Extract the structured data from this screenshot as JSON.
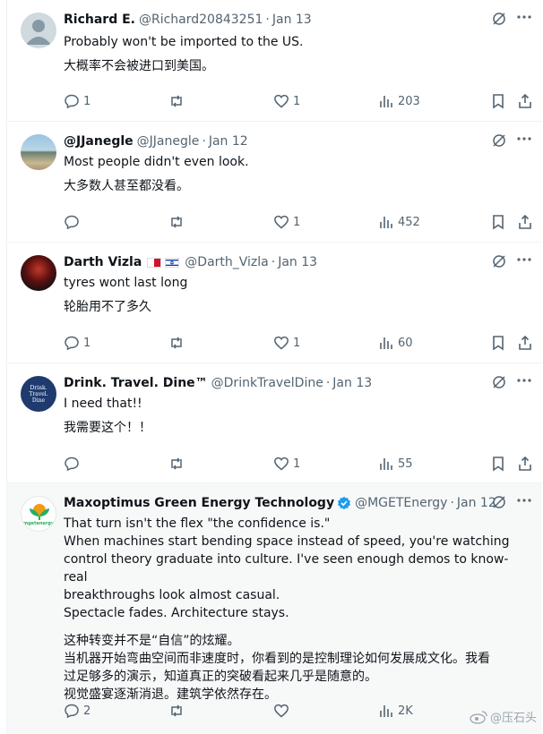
{
  "tweets": [
    {
      "name": "Richard E.",
      "handle": "@Richard20843251",
      "time": "Jan 13",
      "text": [
        "Probably won't be imported to the US."
      ],
      "translation": [
        "大概率不会被进口到美国。"
      ],
      "replies": "1",
      "retweets": "",
      "likes": "1",
      "views": "203"
    },
    {
      "name": "@JJanegle",
      "handle": "@JJanegle",
      "time": "Jan 12",
      "text": [
        "Most people didn't even look."
      ],
      "translation": [
        "大多数人甚至都没看。"
      ],
      "replies": "",
      "retweets": "",
      "likes": "1",
      "views": "452"
    },
    {
      "name": "Darth Vizla",
      "handle": "@Darth_Vizla",
      "time": "Jan 13",
      "text": [
        "tyres wont last long"
      ],
      "translation": [
        "轮胎用不了多久"
      ],
      "replies": "1",
      "retweets": "",
      "likes": "1",
      "views": "60"
    },
    {
      "name": "Drink. Travel. Dine™",
      "handle": "@DrinkTravelDine",
      "time": "Jan 13",
      "text": [
        "I need that!!"
      ],
      "translation": [
        "我需要这个！！"
      ],
      "replies": "",
      "retweets": "",
      "likes": "1",
      "views": "55",
      "avatar_text": "Drink. Travel. Dine"
    },
    {
      "name": "Maxoptimus Green Energy Technology",
      "handle": "@MGETEnergy",
      "time": "Jan 12",
      "text": [
        "That turn isn't the flex \"the confidence is.\"",
        "When machines start bending space instead of speed, you're watching",
        "control theory graduate into culture. I've seen enough demos to know- real",
        "breakthroughs look almost casual.",
        "Spectacle fades. Architecture stays."
      ],
      "translation": [
        "这种转变并不是“自信”的炫耀。",
        "当机器开始弯曲空间而非速度时，你看到的是控制理论如何发展成文化。我看",
        "过足够多的演示，知道真正的突破看起来几乎是随意的。",
        "视觉盛宴逐渐消退。建筑学依然存在。"
      ],
      "replies": "2",
      "retweets": "",
      "likes": "",
      "views": "2K",
      "avatar_text": "mgetenergy"
    }
  ],
  "watermark": "@压石头",
  "colors": {
    "text": "#0f1419",
    "secondary": "#536471",
    "border": "#eff3f4",
    "verified": "#1d9bf0",
    "highlight_bg": "#f7f9f9"
  }
}
